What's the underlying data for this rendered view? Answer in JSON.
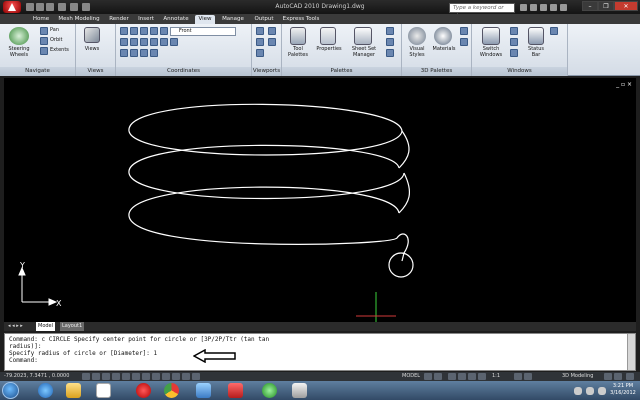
{
  "window": {
    "title": "AutoCAD 2010    Drawing1.dwg",
    "search_placeholder": "Type a keyword or phrase",
    "minimize": "–",
    "restore": "❐",
    "close": "✕"
  },
  "tabs": [
    {
      "label": "Home"
    },
    {
      "label": "Mesh Modeling"
    },
    {
      "label": "Render"
    },
    {
      "label": "Insert"
    },
    {
      "label": "Annotate"
    },
    {
      "label": "View"
    },
    {
      "label": "Manage"
    },
    {
      "label": "Output"
    },
    {
      "label": "Express Tools"
    }
  ],
  "ribbon": {
    "navigate": {
      "label": "Navigate",
      "steering": "Steering\nWheels",
      "pan": "Pan",
      "orbit": "Orbit",
      "extents": "Extents"
    },
    "views": {
      "label": "Views",
      "views": "Views"
    },
    "coordinates": {
      "label": "Coordinates",
      "ucs_view": "Front"
    },
    "viewports": {
      "label": "Viewports"
    },
    "palettes": {
      "label": "Palettes",
      "tool_palettes": "Tool\nPalettes",
      "properties": "Properties",
      "sheet_set": "Sheet Set\nManager"
    },
    "palettes3d": {
      "label": "3D Palettes",
      "visual_styles": "Visual\nStyles",
      "materials": "Materials"
    },
    "windows": {
      "label": "Windows",
      "switch_windows": "Switch\nWindows",
      "status_bar": "Status\nBar"
    }
  },
  "viewport": {
    "controls": "_ ▫ ×",
    "ucs_x": "X",
    "ucs_y": "Y",
    "helix_color": "#ffffff"
  },
  "layout_tabs": {
    "nav": "◂ ◂ ▸ ▸",
    "model": "Model",
    "layout1": "Layout1"
  },
  "command": {
    "lines": [
      "Command: c CIRCLE Specify center point for circle or [3P/2P/Ttr (tan tan",
      "radius)]:",
      "Specify radius of circle or [Diameter]: 1",
      "Command:"
    ]
  },
  "status": {
    "coords": "-79.2023, 7.3471 , 0.0000",
    "model": "MODEL",
    "scale": "1:1",
    "workspace": "3D Modeling"
  },
  "taskbar": {
    "time": "3:21 PM",
    "date": "3/16/2012"
  }
}
